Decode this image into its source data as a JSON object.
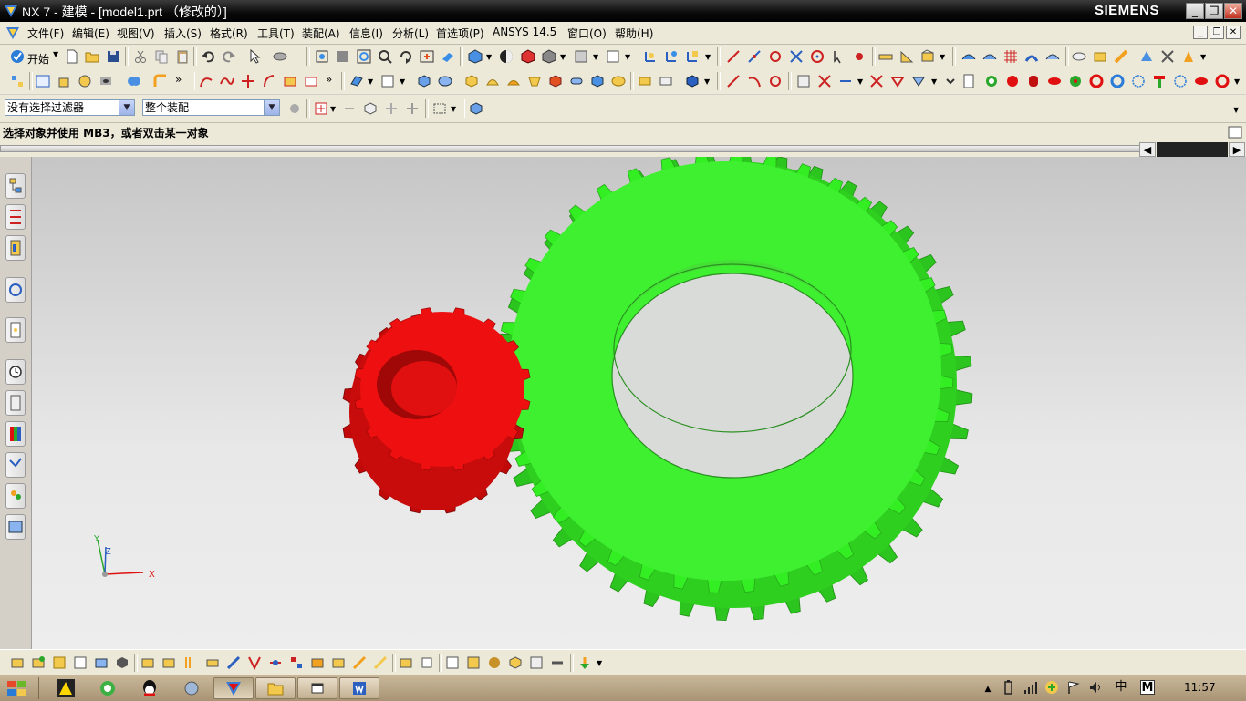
{
  "window": {
    "title": "NX 7 - 建模 - [model1.prt （修改的）]",
    "brand": "SIEMENS",
    "minimize": "_",
    "maximize": "❐",
    "close": "✕"
  },
  "menubar": {
    "items": [
      "文件(F)",
      "编辑(E)",
      "视图(V)",
      "插入(S)",
      "格式(R)",
      "工具(T)",
      "装配(A)",
      "信息(I)",
      "分析(L)",
      "首选项(P)",
      "ANSYS 14.5",
      "窗口(O)",
      "帮助(H)"
    ],
    "mdi_minimize": "_",
    "mdi_restore": "❐",
    "mdi_close": "✕"
  },
  "standard_toolbar": {
    "start_label": "开始"
  },
  "selection_bar": {
    "type_filter": "没有选择过滤器",
    "scope": "整个装配"
  },
  "cue_line": "选择对象并使用 MB3，或者双击某一对象",
  "triad": {
    "x": "X",
    "y": "Y",
    "z": "Z"
  },
  "model": {
    "small_gear_color": "#ee1010",
    "large_gear_color": "#33ee22"
  },
  "taskbar": {
    "ime": "中",
    "ime2": "M",
    "clock": "11:57"
  },
  "colors": {
    "titlebar": "#000000",
    "toolbar_bg": "#ece9d8",
    "viewport_top": "#c6c6c6",
    "viewport_bottom": "#ededed"
  }
}
